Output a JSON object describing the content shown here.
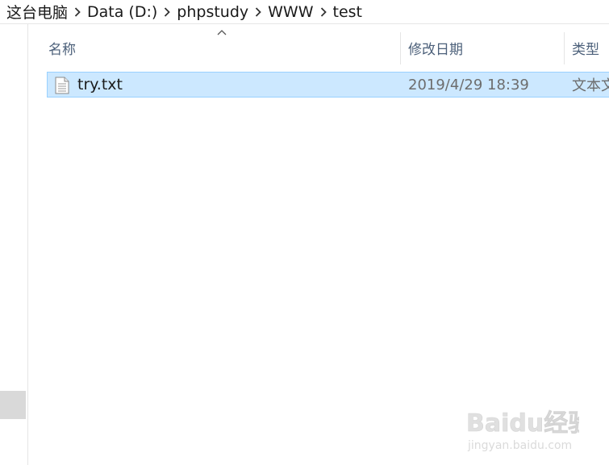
{
  "breadcrumb": {
    "items": [
      "这台电脑",
      "Data (D:)",
      "phpstudy",
      "WWW",
      "test"
    ]
  },
  "columns": {
    "name": "名称",
    "date_modified": "修改日期",
    "type": "类型"
  },
  "files": [
    {
      "name": "try.txt",
      "date_modified": "2019/4/29 18:39",
      "type": "文本文"
    }
  ],
  "watermark": {
    "brand": "Baidu经验",
    "url": "jingyan.baidu.com"
  },
  "colors": {
    "selection_bg": "#cce8ff",
    "selection_border": "#99d1ff",
    "header_text": "#4c607a"
  },
  "icons": {
    "breadcrumb_separator": "chevron-right-icon",
    "sort": "sort-ascending-icon",
    "file": "text-file-icon"
  }
}
